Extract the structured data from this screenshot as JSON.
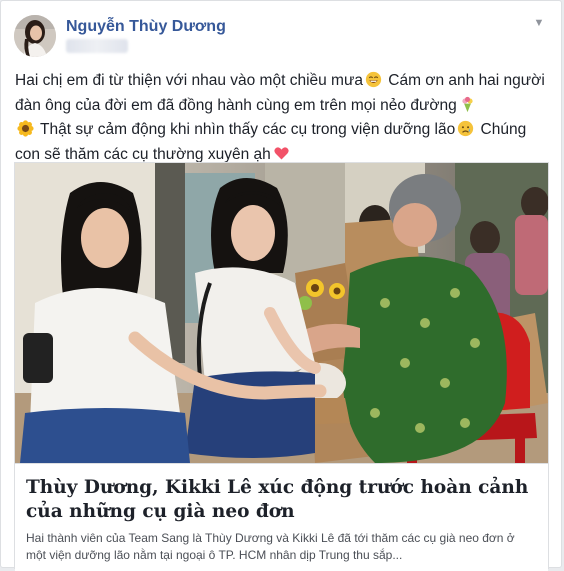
{
  "post": {
    "author_name": "Nguyễn Thùy Dương",
    "menu_icon": "chevron-down-icon",
    "text_parts": [
      "Hai chị em đi từ thiện với nhau vào một chiều mưa",
      " Cám ơn anh hai người đàn ông của đời em đã đồng hành cùng em trên mọi nẻo đường",
      " Thật sự cảm động khi nhìn thấy các cụ trong viện dưỡng lão",
      " Chúng con sẽ thăm các cụ thường xuyên ạh"
    ],
    "emojis": [
      "grinning-face-icon",
      "bouquet-icon",
      "sunflower-icon",
      "sad-face-icon",
      "heart-icon"
    ]
  },
  "link_preview": {
    "title": "Thùy Dương, Kikki Lê xúc động trước hoàn cảnh của những cụ già neo đơn",
    "description": "Hai thành viên của Team Sang là Thùy Dương và Kikki Lê đã tới thăm các cụ già neo đơn ở một viện dưỡng lão nằm tại ngoại ô TP. HCM nhân dịp Trung thu sắp..."
  },
  "colors": {
    "author": "#365899",
    "text": "#1d2129",
    "muted": "#4b4f56",
    "border": "#dddfe2"
  }
}
